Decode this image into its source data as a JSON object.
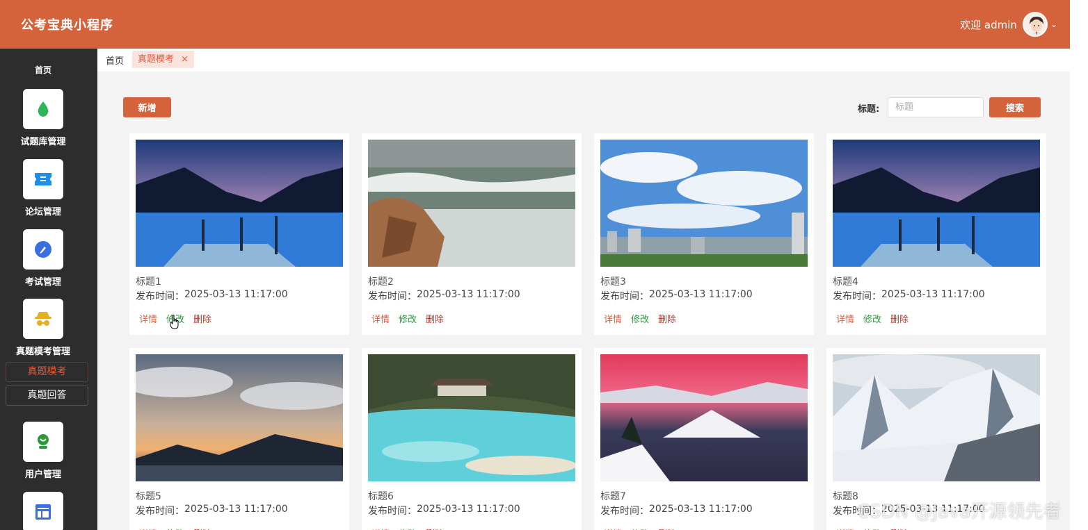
{
  "app": {
    "title": "公考宝典小程序"
  },
  "header": {
    "welcome": "欢迎 admin"
  },
  "sidebar": {
    "home_label": "首页",
    "items": [
      {
        "label": "试题库管理",
        "icon": "drop-icon",
        "color": "#2fb45a"
      },
      {
        "label": "论坛管理",
        "icon": "ticket-icon",
        "color": "#1e8ee6"
      },
      {
        "label": "考试管理",
        "icon": "pencil-icon",
        "color": "#3a6fe0"
      },
      {
        "label": "真题模考管理",
        "icon": "spy-icon",
        "color": "#e2b021"
      },
      {
        "label": "用户管理",
        "icon": "user-icon",
        "color": "#2d9a3a"
      },
      {
        "label": "",
        "icon": "layout-icon",
        "color": "#3a6fe0"
      }
    ],
    "sub_items": [
      {
        "label": "真题模考",
        "active": true
      },
      {
        "label": "真题回答",
        "active": false
      }
    ]
  },
  "tabs": {
    "home": "首页",
    "active": "真题模考",
    "close": "×"
  },
  "toolbar": {
    "add_label": "新增",
    "search_label": "标题:",
    "search_placeholder": "标题",
    "search_button": "搜索"
  },
  "cards": [
    {
      "title": "标题1",
      "date_label": "发布时间：",
      "date": "2025-03-13 11:17:00",
      "detail": "详情",
      "edit": "修改",
      "delete": "删除"
    },
    {
      "title": "标题2",
      "date_label": "发布时间：",
      "date": "2025-03-13 11:17:00",
      "detail": "详情",
      "edit": "修改",
      "delete": "删除"
    },
    {
      "title": "标题3",
      "date_label": "发布时间：",
      "date": "2025-03-13 11:17:00",
      "detail": "详情",
      "edit": "修改",
      "delete": "删除"
    },
    {
      "title": "标题4",
      "date_label": "发布时间：",
      "date": "2025-03-13 11:17:00",
      "detail": "详情",
      "edit": "修改",
      "delete": "删除"
    },
    {
      "title": "标题5",
      "date_label": "发布时间：",
      "date": "2025-03-13 11:17:00",
      "detail": "详情",
      "edit": "修改",
      "delete": "删除"
    },
    {
      "title": "标题6",
      "date_label": "发布时间：",
      "date": "2025-03-13 11:17:00",
      "detail": "详情",
      "edit": "修改",
      "delete": "删除"
    },
    {
      "title": "标题7",
      "date_label": "发布时间：",
      "date": "2025-03-13 11:17:00",
      "detail": "详情",
      "edit": "修改",
      "delete": "删除"
    },
    {
      "title": "标题8",
      "date_label": "发布时间：",
      "date": "2025-03-13 11:17:00",
      "detail": "详情",
      "edit": "修改",
      "delete": "删除"
    }
  ],
  "watermark": "CSDN @Java开源领先者",
  "colors": {
    "header": "#d4623b",
    "sidebar": "#2d2d2d",
    "accent": "#e05a3a",
    "edit": "#2d9a3a",
    "delete": "#c0392b"
  }
}
